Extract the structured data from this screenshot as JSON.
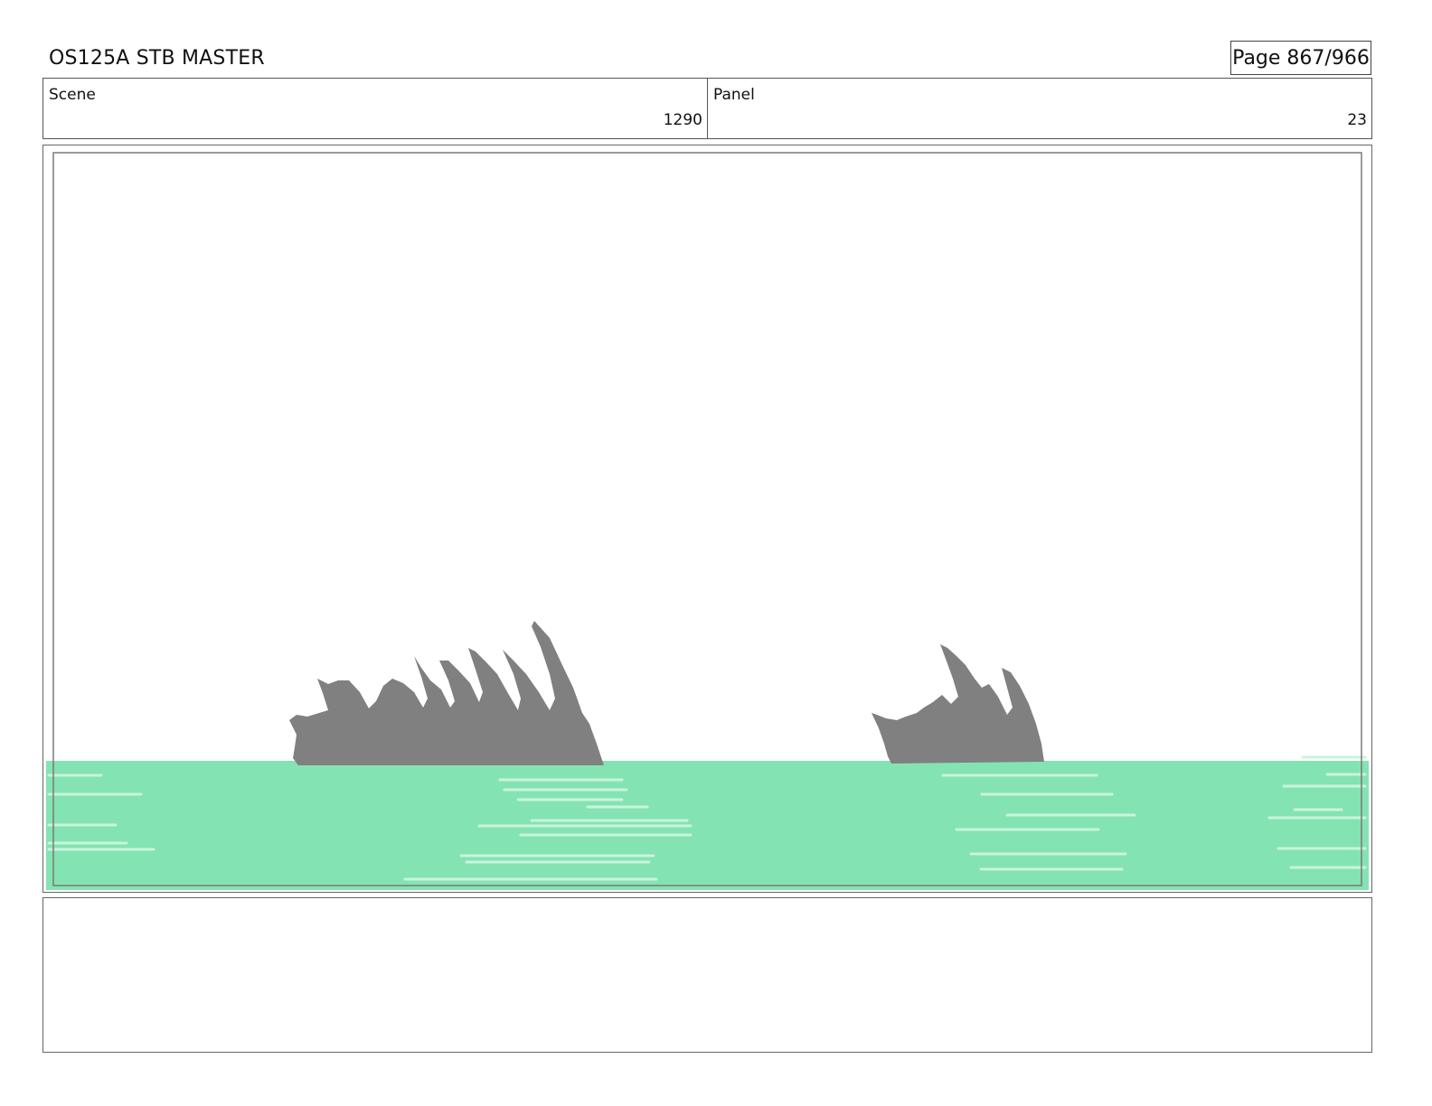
{
  "header": {
    "title": "OS125A STB MASTER",
    "page": "Page 867/966"
  },
  "info": {
    "scene_label": "Scene",
    "scene_value": "1290",
    "panel_label": "Panel",
    "panel_value": "23"
  },
  "colors": {
    "water": "#84e3b2",
    "water_highlight": "#c9f4dd",
    "rock": "#808080"
  },
  "notes": ""
}
